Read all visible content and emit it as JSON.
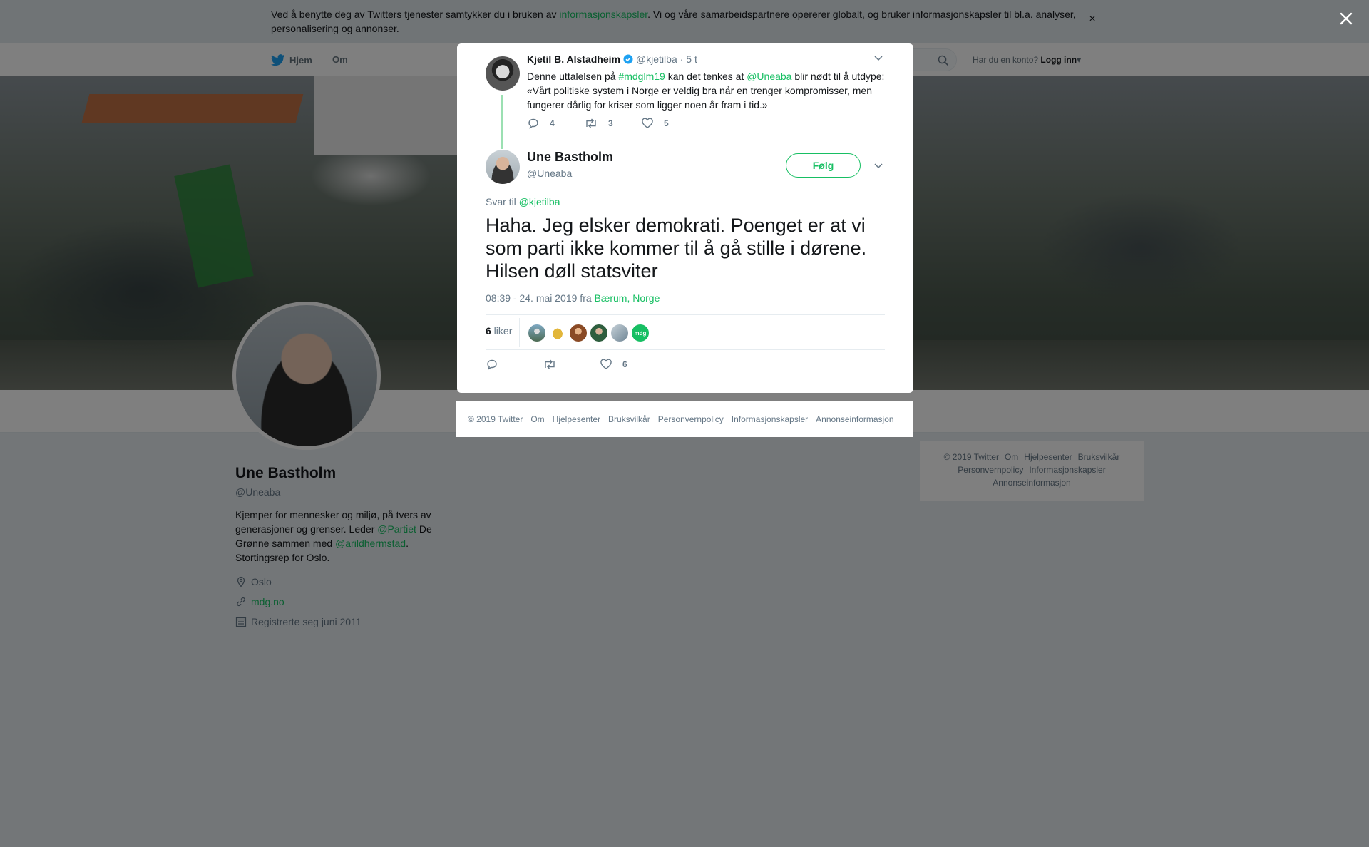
{
  "cookie": {
    "text_before": "Ved å benytte deg av Twitters tjenester samtykker du i bruken av ",
    "link": "informasjonskapsler",
    "text_after": ". Vi og våre samarbeidspartnere opererer globalt, og bruker informasjonskapsler til bl.a. analyser, personalisering og annonser.",
    "close_icon": "×"
  },
  "topbar": {
    "home_label": "Hjem",
    "about_label": "Om",
    "login_prompt": "Har du en konto?",
    "login_label": "Logg inn"
  },
  "profile": {
    "name": "Une Bastholm",
    "handle": "@Uneaba",
    "bio_1": "Kjemper for mennesker og miljø, på tvers av generasjoner og grenser. Leder ",
    "bio_link1": "@Partiet",
    "bio_2": " De Grønne sammen med ",
    "bio_link2": "@arildhermstad",
    "bio_3": ". Stortingsrep for Oslo.",
    "location": "Oslo",
    "website": "mdg.no",
    "joined": "Registrerte seg juni 2011"
  },
  "right_footer": {
    "items": [
      "© 2019 Twitter",
      "Om",
      "Hjelpesenter",
      "Bruksvilkår",
      "Personvernpolicy",
      "Informasjonskapsler",
      "Annonseinformasjon"
    ]
  },
  "parent_tweet": {
    "name": "Kjetil B. Alstadheim",
    "handle": "@kjetilba",
    "time": "· 5 t",
    "text_1": "Denne uttalelsen på ",
    "hashtag": "#mdglm19",
    "text_2": " kan det tenkes at ",
    "mention": "@Uneaba",
    "text_3": " blir nødt til å utdype: «Vårt politiske system i Norge er veldig bra når en trenger kompromisser, men fungerer dårlig for kriser som ligger noen år fram i tid.»",
    "replies": "4",
    "retweets": "3",
    "likes": "5"
  },
  "main_tweet": {
    "name": "Une Bastholm",
    "handle": "@Uneaba",
    "follow_label": "Følg",
    "reply_to_label": "Svar til ",
    "reply_to_handle": "@kjetilba",
    "text": "Haha. Jeg elsker demokrati. Poenget er at vi som parti ikke kommer til å gå stille i dørene. Hilsen døll statsviter",
    "timestamp": "08:39 - 24. mai 2019 fra ",
    "location": "Bærum, Norge",
    "likes_count": "6",
    "likes_label": " liker",
    "likes_action": "6",
    "liker_face_colors": [
      "#6b8e9f",
      "#d4a017",
      "#b5651d",
      "#2e5e3e",
      "#8fa3b0",
      "#17bf63"
    ],
    "liker_mdg_badge": "mdg"
  },
  "modal_footer": {
    "items": [
      "© 2019 Twitter",
      "Om",
      "Hjelpesenter",
      "Bruksvilkår",
      "Personvernpolicy",
      "Informasjonskapsler",
      "Annonseinformasjon"
    ]
  },
  "colors": {
    "accent": "#17bf63",
    "verified": "#1da1f2",
    "text": "#14171a",
    "muted": "#657786"
  }
}
